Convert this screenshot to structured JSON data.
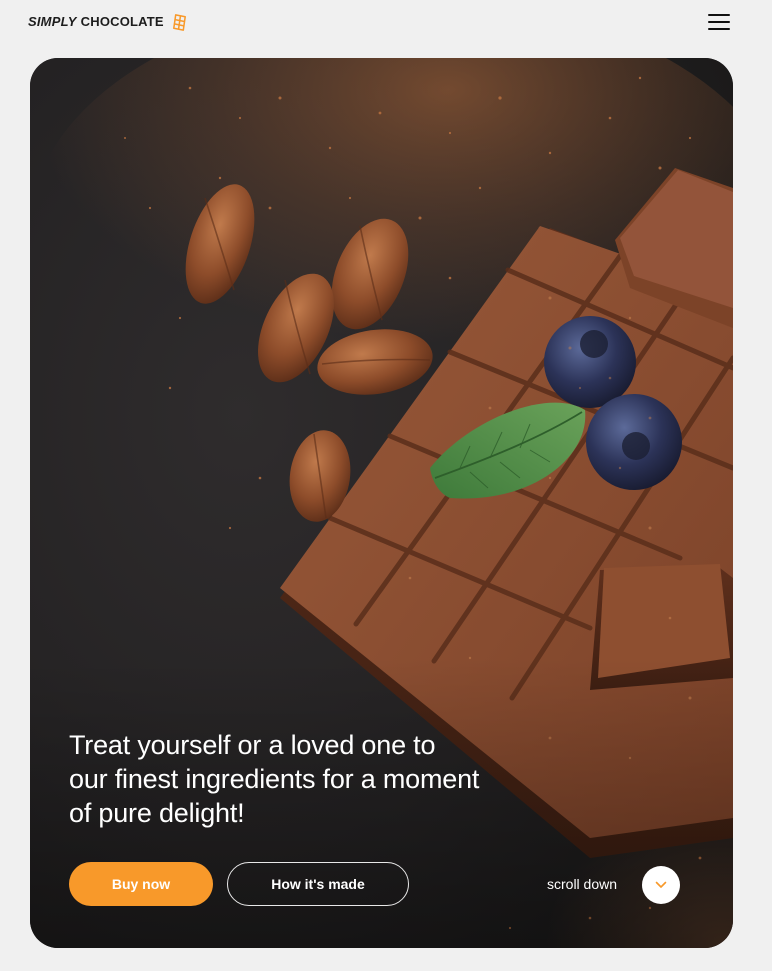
{
  "header": {
    "logo_simply": "SIMPLY",
    "logo_brand": "CHOCOLATE",
    "logo_icon": "chocolate-bar-icon",
    "menu_icon": "hamburger-menu-icon"
  },
  "hero": {
    "headline_line1": "Treat yourself or a loved one to",
    "headline_line2": "our finest ingredients for a moment",
    "headline_line3": "of pure delight!",
    "buy_label": "Buy now",
    "how_label": "How it's made",
    "scroll_label": "scroll down",
    "scroll_icon": "chevron-down-icon"
  },
  "colors": {
    "accent": "#f8992a",
    "page_bg": "#f0f0f0",
    "hero_bg": "#262425",
    "text_dark": "#1d1d1d",
    "text_light": "#ffffff"
  }
}
